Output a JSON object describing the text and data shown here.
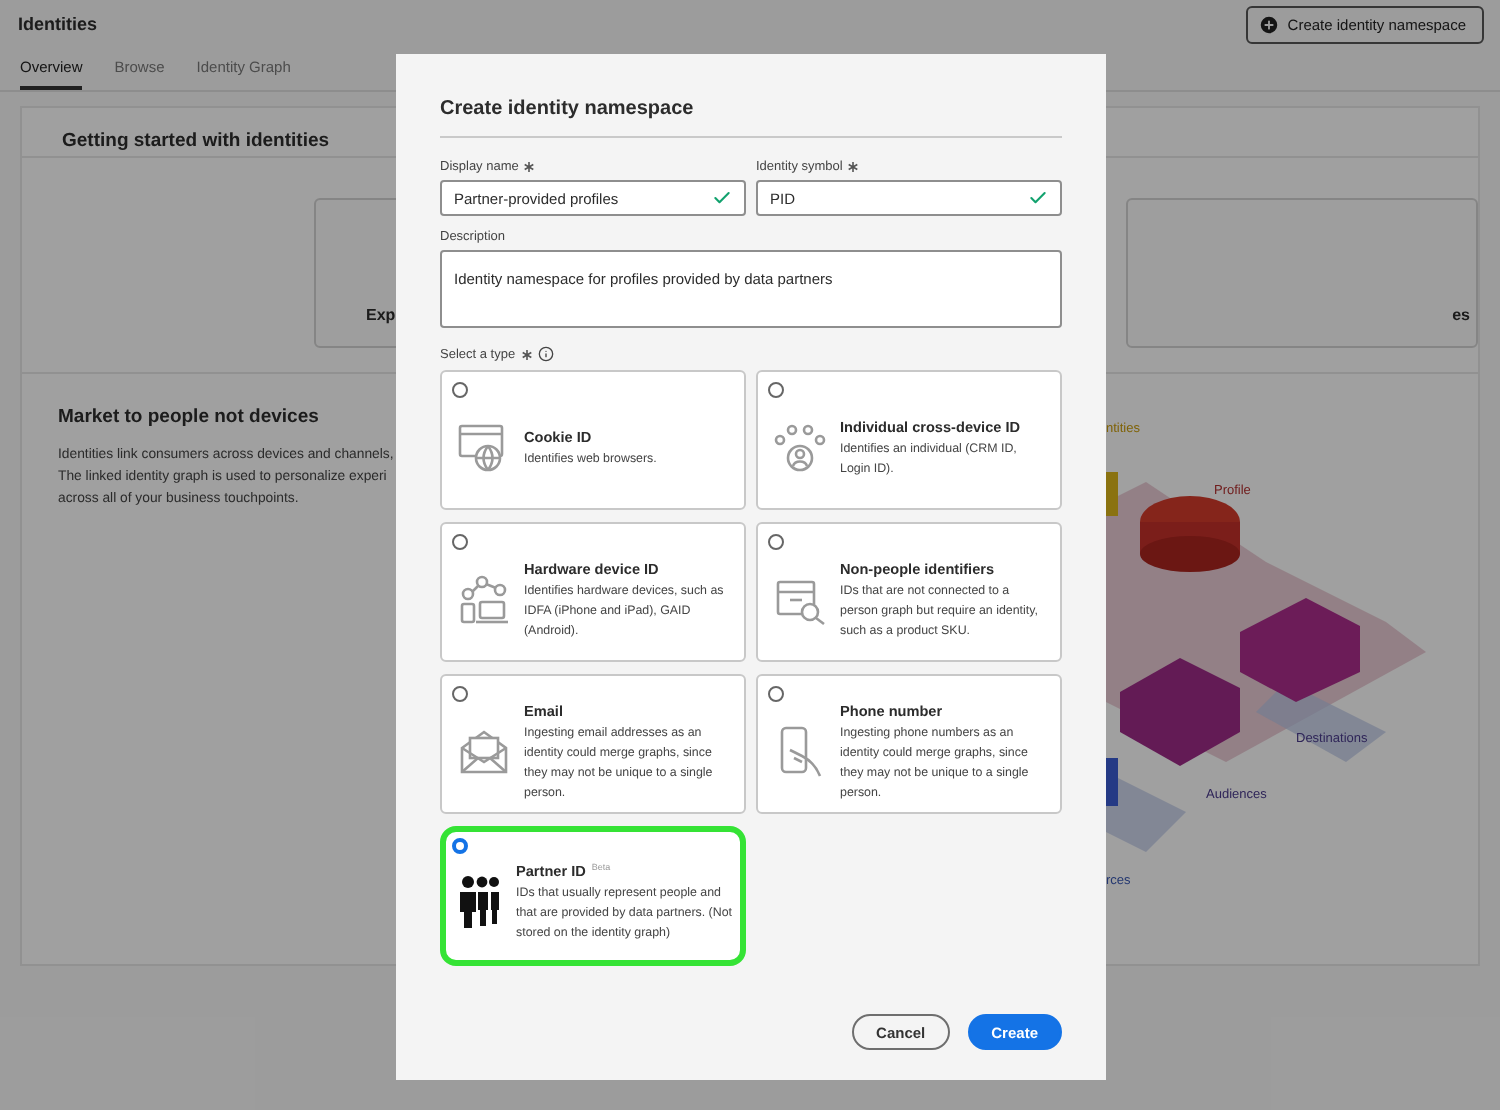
{
  "page": {
    "title": "Identities",
    "create_button": "Create identity namespace",
    "tabs": [
      {
        "label": "Overview",
        "selected": true
      },
      {
        "label": "Browse",
        "selected": false
      },
      {
        "label": "Identity Graph",
        "selected": false
      }
    ],
    "section_title": "Getting started with identities",
    "card_fragments": [
      "Exp",
      "es"
    ],
    "market": {
      "title": "Market to people not devices",
      "lines": [
        "Identities link consumers across devices and channels,",
        "The linked identity graph is used to personalize experi",
        "across all of your business touchpoints."
      ]
    },
    "illustration_labels": [
      "ntities",
      "Profile",
      "Destinations",
      "Audiences",
      "rces"
    ]
  },
  "dialog": {
    "title": "Create identity namespace",
    "fields": [
      {
        "label": "Display name",
        "required": true,
        "value": "Partner-provided profiles",
        "valid": true
      },
      {
        "label": "Identity symbol",
        "required": true,
        "value": "PID",
        "valid": true
      }
    ],
    "description": {
      "label": "Description",
      "value": "Identity namespace for profiles provided by data partners"
    },
    "type_label": "Select a type",
    "type_required": true,
    "types": [
      {
        "kind": "cookie",
        "title": "Cookie ID",
        "description": "Identifies web browsers.",
        "selected": false
      },
      {
        "kind": "individual",
        "title": "Individual cross-device ID",
        "description": "Identifies an individual (CRM ID, Login ID).",
        "selected": false
      },
      {
        "kind": "hardware",
        "title": "Hardware device ID",
        "description": "Identifies hardware devices, such as IDFA (iPhone and iPad), GAID (Android).",
        "selected": false
      },
      {
        "kind": "nonpeople",
        "title": "Non-people identifiers",
        "description": "IDs that are not connected to a person graph but require an identity, such as a product SKU.",
        "selected": false
      },
      {
        "kind": "email",
        "title": "Email",
        "description": "Ingesting email addresses as an identity could merge graphs, since they may not be unique to a single person.",
        "selected": false
      },
      {
        "kind": "phone",
        "title": "Phone number",
        "description": "Ingesting phone numbers as an identity could merge graphs, since they may not be unique to a single person.",
        "selected": false
      },
      {
        "kind": "partner",
        "title": "Partner ID",
        "badge": "Beta",
        "description": "IDs that usually represent people and that are provided by data partners. (Not stored on the identity graph)",
        "selected": true
      }
    ],
    "buttons": [
      {
        "label": "Cancel",
        "kind": "secondary"
      },
      {
        "label": "Create",
        "kind": "primary"
      }
    ]
  }
}
